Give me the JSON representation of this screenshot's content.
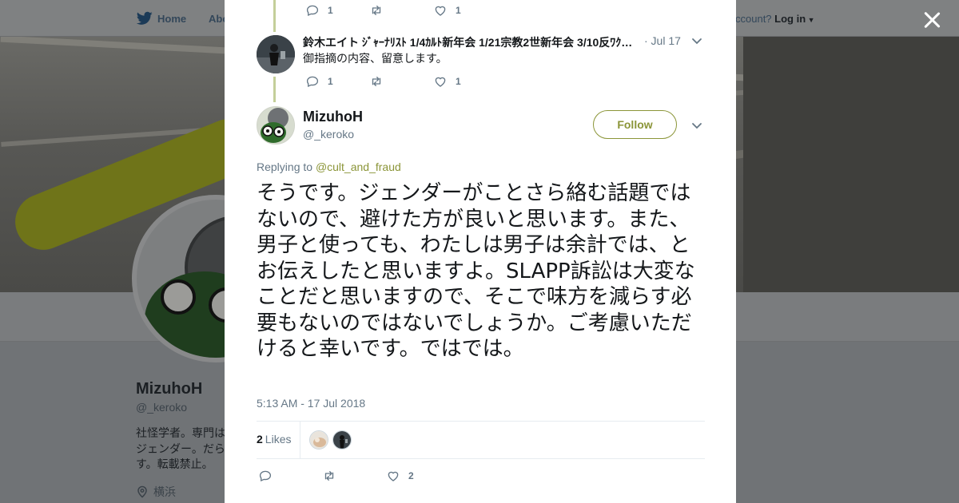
{
  "topbar": {
    "home_label": "Home",
    "about_label": "Abo",
    "account_prompt": "ccount?",
    "login_label": "Log in"
  },
  "profile": {
    "name": "MizuhoH",
    "handle": "@_keroko",
    "bio": "社怪学者。専門はジェンダー。だらす。転載禁止。",
    "location": "横浜"
  },
  "thread": {
    "top_tweet": {
      "reply_count": "1",
      "like_count": "1"
    },
    "reply_tweet": {
      "author": "鈴木エイト ｼﾞｬｰﾅﾘｽﾄ 1/4ｶﾙﾄ新年会 1/21宗教2世新年会 3/10反ﾜｸ…",
      "date": "· Jul 17",
      "text": "御指摘の内容、留意します。",
      "reply_count": "1",
      "like_count": "1"
    }
  },
  "main_tweet": {
    "name": "MizuhoH",
    "handle": "@_keroko",
    "follow_label": "Follow",
    "replying_prefix": "Replying to",
    "replying_to": "@cult_and_fraud",
    "text": "そうです。ジェンダーがことさら絡む話題ではないので、避けた方が良いと思います。また、男子と使っても、わたしは男子は余計では、とお伝えしたと思いますよ。SLAPP訴訟は大変なことだと思いますので、そこで味方を減らす必要もないのではないでしょうか。ご考慮いただけると幸いです。ではでは。",
    "timestamp": "5:13 AM - 17 Jul 2018",
    "likes_count": "2",
    "likes_label": "Likes",
    "action_like_count": "2"
  },
  "colors": {
    "accent": "#8b9538",
    "thread_line": "#c4cf9a",
    "muted": "#657786"
  },
  "icons": [
    "twitter-bird-icon",
    "close-icon",
    "reply-icon",
    "retweet-icon",
    "heart-icon",
    "chevron-down-icon",
    "location-pin-icon"
  ]
}
